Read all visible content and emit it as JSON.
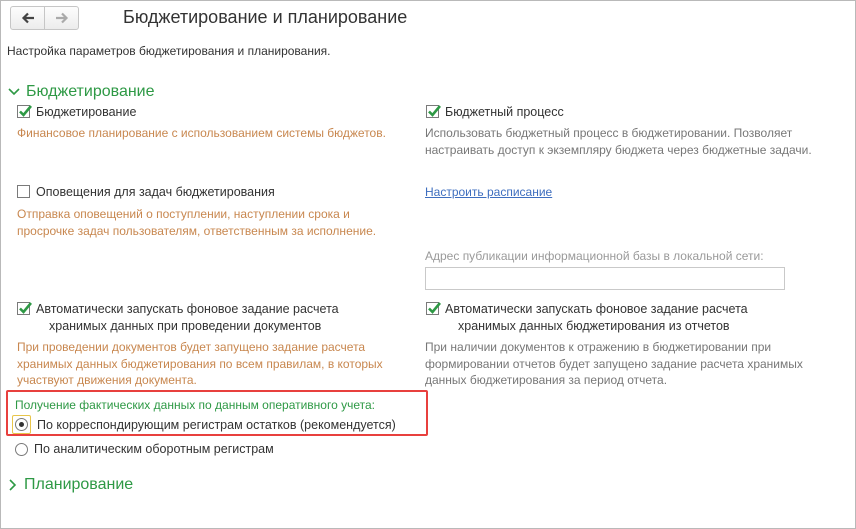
{
  "header": {
    "title": "Бюджетирование и планирование",
    "back_icon": "arrow-left-icon",
    "forward_icon": "arrow-right-icon"
  },
  "subtitle": "Настройка параметров бюджетирования и планирования.",
  "sections": {
    "budgeting": {
      "label": "Бюджетирование",
      "expanded": true
    },
    "planning": {
      "label": "Планирование",
      "expanded": false
    }
  },
  "options": {
    "budgeting": {
      "label": "Бюджетирование",
      "checked": true,
      "description": "Финансовое планирование с использованием системы бюджетов."
    },
    "budget_process": {
      "label": "Бюджетный процесс",
      "checked": true,
      "description": "Использовать бюджетный процесс в бюджетировании. Позволяет настраивать доступ к экземпляру бюджета через бюджетные задачи."
    },
    "notifications": {
      "label": "Оповещения для задач бюджетирования",
      "checked": false,
      "description": "Отправка оповещений о поступлении, наступлении срока и просрочке задач пользователям, ответственным за исполнение."
    },
    "schedule_link": "Настроить расписание",
    "publication_address": {
      "label": "Адрес публикации информационной базы в локальной сети:",
      "value": ""
    },
    "auto_on_documents": {
      "label_line1": "Автоматически запускать фоновое задание расчета",
      "label_line2": "хранимых данных при проведении документов",
      "checked": true,
      "description": "При проведении документов будет запущено задание расчета хранимых данных бюджетирования по всем правилам, в которых участвуют движения документа."
    },
    "auto_from_reports": {
      "label_line1": "Автоматически запускать фоновое задание расчета",
      "label_line2": "хранимых данных бюджетирования из отчетов",
      "checked": true,
      "description": "При наличии документов к отражению в бюджетировании при формировании отчетов будет запущено задание расчета хранимых данных бюджетирования за период отчета."
    }
  },
  "actual_data": {
    "label": "Получение фактических данных по данным оперативного учета:",
    "selected": 0,
    "options": [
      "По корреспондирующим регистрам остатков (рекомендуется)",
      "По аналитическим оборотным регистрам"
    ]
  },
  "colors": {
    "section_green": "#2e9945",
    "description_orange": "#c8874f",
    "link_blue": "#3e6ebf",
    "highlight_red": "#e8403e"
  }
}
